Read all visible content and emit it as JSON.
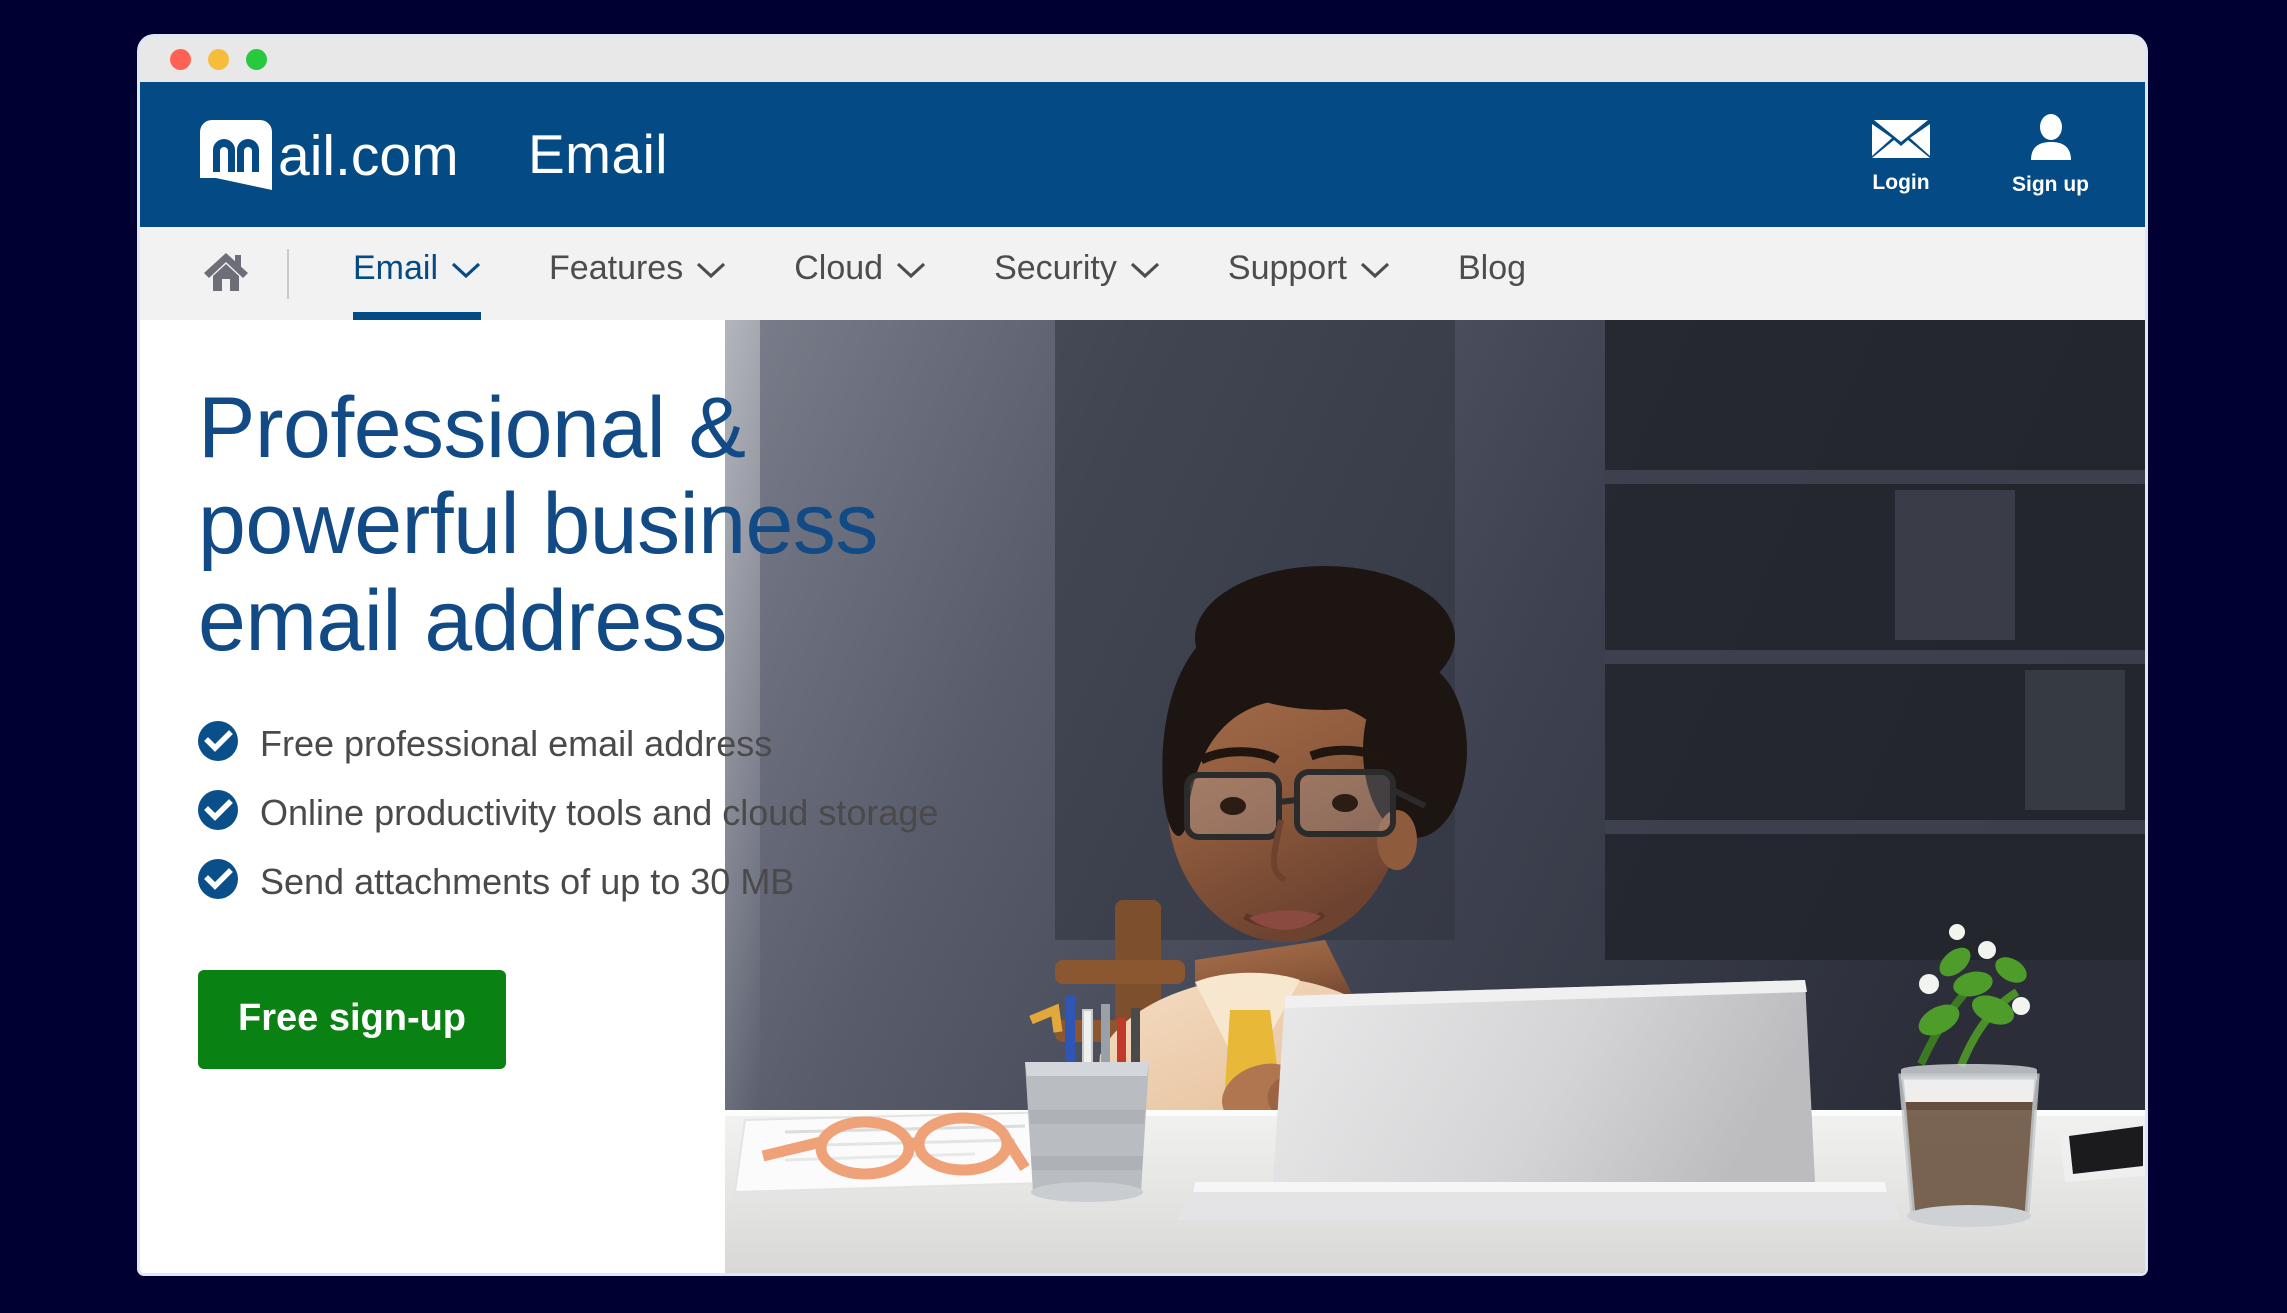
{
  "window": {
    "controls": [
      {
        "name": "close",
        "color": "#ff6155"
      },
      {
        "name": "minimize",
        "color": "#f6bd3b"
      },
      {
        "name": "maximize",
        "color": "#27c93f"
      }
    ]
  },
  "header": {
    "logo_text": "mail.com",
    "title": "Email",
    "background": "#044b85",
    "actions": [
      {
        "icon": "envelope-icon",
        "label": "Login"
      },
      {
        "icon": "person-icon",
        "label": "Sign up"
      }
    ]
  },
  "nav": {
    "home_icon": "home-icon",
    "background": "#f2f2f2",
    "active_color": "#044b85",
    "items": [
      {
        "label": "Email",
        "has_chevron": true,
        "active": true
      },
      {
        "label": "Features",
        "has_chevron": true,
        "active": false
      },
      {
        "label": "Cloud",
        "has_chevron": true,
        "active": false
      },
      {
        "label": "Security",
        "has_chevron": true,
        "active": false
      },
      {
        "label": "Support",
        "has_chevron": true,
        "active": false
      },
      {
        "label": "Blog",
        "has_chevron": false,
        "active": false
      }
    ]
  },
  "hero": {
    "headline_line1": "Professional &",
    "headline_line2": "powerful business",
    "headline_line3": "email address",
    "headline_color": "#114a85",
    "bullets": [
      "Free professional email address",
      "Online productivity tools and cloud storage",
      "Send attachments of up to 30 MB"
    ],
    "bullet_icon": "check-circle-icon",
    "cta_label": "Free sign-up",
    "cta_color": "#0a8113",
    "image_alt": "Woman with glasses at a desk with laptop, pen cup, papers and a plant"
  }
}
